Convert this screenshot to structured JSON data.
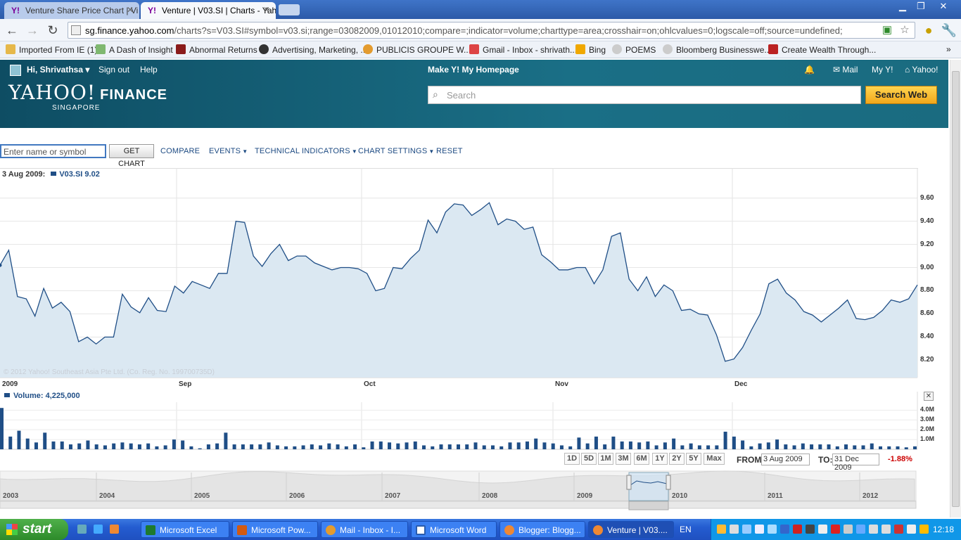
{
  "browser": {
    "tabs": [
      {
        "label": "Venture Share Price Chart | Vi"
      },
      {
        "label": "Venture | V03.SI | Charts - Yah"
      }
    ],
    "url_host": "sg.finance.yahoo.com",
    "url_path": "/charts?s=V03.SI#symbol=v03.si;range=03082009,01012010;compare=;indicator=volume;charttype=area;crosshair=on;ohlcvalues=0;logscale=off;source=undefined;",
    "bookmarks": [
      "Imported From IE (1)",
      "A Dash of Insight",
      "Abnormal Returns",
      "Advertising, Marketing, ...",
      "PUBLICIS GROUPE W...",
      "Gmail - Inbox - shrivath...",
      "Bing",
      "POEMS",
      "Bloomberg Businesswe...",
      "Create Wealth Through..."
    ]
  },
  "yahoo": {
    "greeting": "Hi, Shrivathsa",
    "sign_out": "Sign out",
    "help": "Help",
    "make_homepage": "Make Y! My Homepage",
    "mail": "Mail",
    "my_y": "My Y!",
    "yahoo": "Yahoo!",
    "logo": "YAHOO!",
    "logo_finance": "FINANCE",
    "logo_region": "SINGAPORE",
    "search_placeholder": "Search",
    "search_button": "Search Web"
  },
  "controls": {
    "symbol_placeholder": "Enter name or symbol",
    "get_chart": "GET CHART",
    "compare": "COMPARE",
    "events": "EVENTS",
    "technical_indicators": "TECHNICAL INDICATORS",
    "chart_settings": "CHART SETTINGS",
    "reset": "RESET"
  },
  "readout": {
    "date": "3 Aug 2009:",
    "series": "V03.SI 9.02"
  },
  "copyright": "© 2012 Yahoo! Southeast Asia Pte Ltd. (Co. Reg. No. 199700735D)",
  "volume_label": "Volume: 4,225,000",
  "range_buttons": [
    "1D",
    "5D",
    "1M",
    "3M",
    "6M",
    "1Y",
    "2Y",
    "5Y",
    "Max"
  ],
  "from_label": "FROM:",
  "from_value": "3 Aug 2009",
  "to_label": "TO:",
  "to_value": "31 Dec 2009",
  "change_pct": "-1.88%",
  "navigator_years": [
    "2003",
    "2004",
    "2005",
    "2006",
    "2007",
    "2008",
    "2009",
    "2010",
    "2011",
    "2012"
  ],
  "taskbar": {
    "start": "start",
    "items": [
      "Microsoft Excel",
      "Microsoft Pow...",
      "Mail - Inbox - I...",
      "Microsoft Word",
      "Blogger: Blogg...",
      "Venture | V03...."
    ],
    "lang": "EN",
    "clock": "12:18"
  },
  "colors": {
    "line": "#1f4e86",
    "area": "#dbe8f2",
    "volume": "#1f4e86",
    "negative": "#cc0000",
    "header": "#1a6f86"
  },
  "chart_data": [
    {
      "type": "area",
      "title": "",
      "series_name": "V03.SI",
      "x_tick_labels": [
        "2009",
        "Sep",
        "Oct",
        "Nov",
        "Dec"
      ],
      "y_tick_labels": [
        "8.20",
        "8.40",
        "8.60",
        "8.80",
        "9.00",
        "9.20",
        "9.40",
        "9.60"
      ],
      "ylim": [
        8.05,
        9.75
      ],
      "grid": true,
      "values": [
        9.02,
        9.15,
        8.75,
        8.73,
        8.58,
        8.82,
        8.65,
        8.7,
        8.62,
        8.36,
        8.4,
        8.34,
        8.4,
        8.4,
        8.77,
        8.66,
        8.61,
        8.74,
        8.63,
        8.62,
        8.84,
        8.78,
        8.88,
        8.85,
        8.82,
        8.95,
        8.95,
        9.4,
        9.39,
        9.1,
        9.01,
        9.12,
        9.2,
        9.06,
        9.1,
        9.1,
        9.04,
        9.01,
        8.98,
        9.0,
        9.0,
        8.99,
        8.95,
        8.8,
        8.82,
        9.0,
        8.99,
        9.08,
        9.15,
        9.41,
        9.3,
        9.48,
        9.55,
        9.54,
        9.45,
        9.5,
        9.56,
        9.37,
        9.42,
        9.4,
        9.33,
        9.35,
        9.11,
        9.05,
        8.98,
        8.98,
        9.0,
        9.0,
        8.86,
        8.98,
        9.27,
        9.3,
        8.9,
        8.8,
        8.92,
        8.75,
        8.85,
        8.8,
        8.63,
        8.64,
        8.6,
        8.59,
        8.42,
        8.19,
        8.21,
        8.31,
        8.46,
        8.6,
        8.86,
        8.9,
        8.78,
        8.72,
        8.62,
        8.59,
        8.53,
        8.59,
        8.65,
        8.72,
        8.56,
        8.55,
        8.57,
        8.63,
        8.72,
        8.7,
        8.73,
        8.85
      ]
    },
    {
      "type": "bar",
      "title": "",
      "series_name": "Volume",
      "y_tick_labels": [
        "1.0M",
        "2.0M",
        "3.0M",
        "4.0M"
      ],
      "ylim": [
        0,
        4600000
      ],
      "values": [
        4225000,
        1300000,
        1900000,
        1100000,
        700000,
        1700000,
        800000,
        800000,
        500000,
        600000,
        900000,
        500000,
        400000,
        600000,
        700000,
        600000,
        500000,
        600000,
        300000,
        400000,
        1000000,
        900000,
        300000,
        100000,
        500000,
        600000,
        1700000,
        500000,
        500000,
        500000,
        500000,
        700000,
        400000,
        300000,
        300000,
        400000,
        500000,
        400000,
        600000,
        500000,
        300000,
        500000,
        200000,
        800000,
        800000,
        700000,
        600000,
        700000,
        800000,
        400000,
        300000,
        500000,
        500000,
        500000,
        500000,
        700000,
        400000,
        400000,
        300000,
        700000,
        700000,
        800000,
        1100000,
        700000,
        600000,
        400000,
        300000,
        1200000,
        600000,
        1300000,
        500000,
        1300000,
        800000,
        800000,
        700000,
        800000,
        400000,
        700000,
        1100000,
        400000,
        600000,
        400000,
        400000,
        400000,
        1800000,
        1300000,
        900000,
        300000,
        600000,
        700000,
        1000000,
        500000,
        400000,
        600000,
        500000,
        500000,
        500000,
        300000,
        500000,
        400000,
        400000,
        600000,
        300000,
        300000,
        300000,
        200000,
        300000
      ]
    }
  ]
}
